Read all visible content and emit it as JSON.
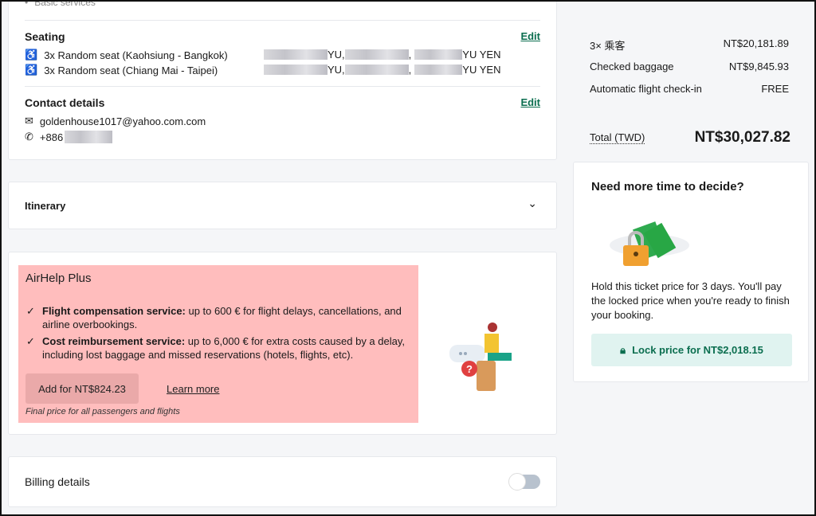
{
  "summary_top": {
    "basic_services": "Basic services"
  },
  "seating": {
    "title": "Seating",
    "edit": "Edit",
    "items": [
      {
        "label": "3x Random seat (Kaohsiung - Bangkok)",
        "names": [
          "YU,",
          ",",
          "YU YEN"
        ]
      },
      {
        "label": "3x Random seat (Chiang Mai - Taipei)",
        "names": [
          "YU,",
          ",",
          "YU YEN"
        ]
      }
    ]
  },
  "contact": {
    "title": "Contact details",
    "edit": "Edit",
    "email": "goldenhouse1017@yahoo.com.com",
    "phone": "+886"
  },
  "itinerary": {
    "title": "Itinerary"
  },
  "airhelp": {
    "title": "AirHelp Plus",
    "features": [
      {
        "bold": "Flight compensation service:",
        "text": " up to 600 € for flight delays, cancellations, and airline overbookings."
      },
      {
        "bold": "Cost reimbursement service:",
        "text": " up to 6,000 € for extra costs caused by a delay, including lost baggage and missed reservations (hotels, flights, etc)."
      }
    ],
    "add_button": "Add for NT$824.23",
    "learn_more": "Learn more",
    "note": "Final price for all passengers and flights",
    "highlight_color": "#ffbdbd"
  },
  "billing": {
    "title": "Billing details",
    "toggle_on": false
  },
  "price_summary": {
    "lines": [
      {
        "label": "3× 乘客",
        "value": "NT$20,181.89"
      },
      {
        "label": "Checked baggage",
        "value": "NT$9,845.93"
      },
      {
        "label": "Automatic flight check-in",
        "value": "FREE"
      }
    ],
    "total_label": "Total (TWD)",
    "total_value": "NT$30,027.82"
  },
  "lock": {
    "title": "Need more time to decide?",
    "text": "Hold this ticket price for 3 days. You'll pay the locked price when you're ready to finish your booking.",
    "button": "Lock price for NT$2,018.15",
    "accent": "#0b6e4f"
  }
}
